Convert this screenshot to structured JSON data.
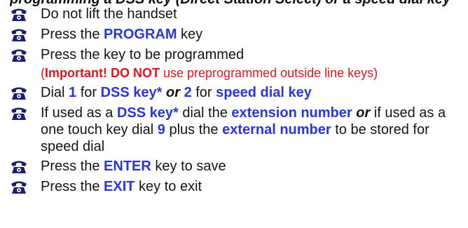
{
  "header": {
    "title": "programming a DSS key (Direct Station Select) or a speed dial key"
  },
  "colors": {
    "accent_blue": "#2a34e4",
    "warning_red": "#e0161b",
    "icon_navy": "#1a2070"
  },
  "steps": [
    {
      "text": "Do not lift the handset"
    },
    {
      "pre": "Press the ",
      "key": "PROGRAM",
      "post": " key"
    },
    {
      "text": "Press the key to be programmed"
    },
    {
      "pre": "Dial ",
      "n1": "1",
      "mid1": " for ",
      "k1": "DSS key*",
      "or": "or",
      "n2": "2",
      "mid2": " for ",
      "k2": "speed dial key"
    },
    {
      "a": "If used as a ",
      "b": "DSS key*",
      "c": " dial the ",
      "d": "extension number",
      "e": "or",
      "f": " if used as a one touch key dial ",
      "g": "9",
      "h": " plus the ",
      "i": "external number",
      "j": " to be stored for speed dial"
    },
    {
      "pre": "Press the ",
      "key": "ENTER",
      "post": " key to save"
    },
    {
      "pre": "Press the ",
      "key": "EXIT",
      "post": " key to exit"
    }
  ],
  "note": {
    "open": "(",
    "important": "Important! DO NOT",
    "rest": " use preprogrammed outside line keys)"
  },
  "icon": "telephone-icon"
}
